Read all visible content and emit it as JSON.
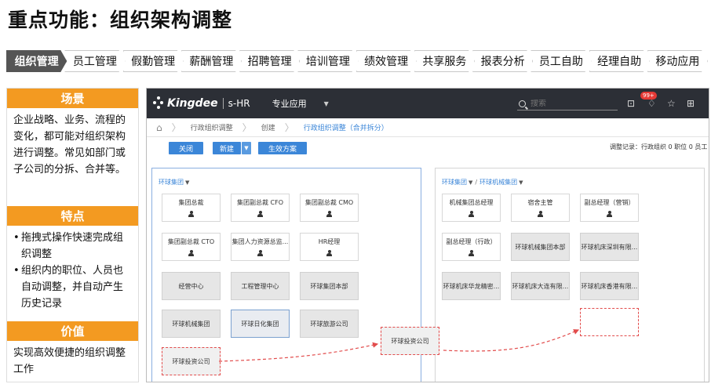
{
  "title": "重点功能：组织架构调整",
  "nav": {
    "tabs": [
      "组织管理",
      "员工管理",
      "假勤管理",
      "薪酬管理",
      "招聘管理",
      "培训管理",
      "绩效管理",
      "共享服务",
      "报表分析",
      "员工自助",
      "经理自助",
      "移动应用"
    ],
    "active_index": 0
  },
  "sections": {
    "scenario": {
      "title": "场景",
      "text": "企业战略、业务、流程的变化，都可能对组织架构进行调整。常见如部门或子公司的分拆、合并等。"
    },
    "features": {
      "title": "特点",
      "items": [
        "拖拽式操作快速完成组织调整",
        "组织内的职位、人员也自动调整，并自动产生历史记录"
      ]
    },
    "value": {
      "title": "价值",
      "text": "实现高效便捷的组织调整工作"
    }
  },
  "app": {
    "brand": "Kingdee",
    "product": "s-HR",
    "menu": "专业应用",
    "search_placeholder": "搜索",
    "notification_count": "99+",
    "breadcrumb": [
      "行政组织调整",
      "创建",
      "行政组织调整（合并拆分）"
    ],
    "buttons": {
      "close": "关闭",
      "new": "新建",
      "apply": "生效方案"
    },
    "adjust_record": "调整记录：行政组织 0   职位 0   员工 0",
    "left_panel": {
      "title": "环球集团",
      "positions": [
        "集团总裁",
        "集团副总裁 CFO",
        "集团副总裁 CMO",
        "集团副总裁 CTO",
        "集团人力资源总监...",
        "HR经理"
      ],
      "depts": [
        "经营中心",
        "工程管理中心",
        "环球集团本部",
        "环球机械集团",
        "环球日化集团",
        "环球旅游公司"
      ],
      "moving": "环球投资公司"
    },
    "right_panel": {
      "title": "环球集团",
      "subtitle": "环球机械集团",
      "positions": [
        "机械集团总经理",
        "宿舍主管",
        "副总经理（营销）",
        "副总经理（行政）"
      ],
      "depts": [
        "环球机械集团本部",
        "环球机床深圳有限...",
        "环球机床华龙精密...",
        "环球机床大连有限...",
        "环球机床香港有限..."
      ]
    },
    "dragging": "环球投资公司"
  }
}
